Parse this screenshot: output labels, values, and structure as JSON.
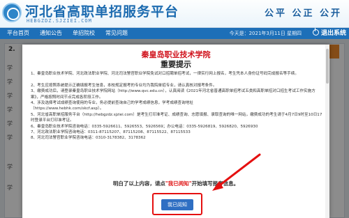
{
  "header": {
    "title": "河北省高职单招服务平台",
    "url": "HEBGZDZ.SJZIEI.COM",
    "slogan": "公平  公正  公开"
  },
  "nav": {
    "items": [
      "平台首页",
      "通知公告",
      "单招院校",
      "常见问题"
    ],
    "date": "今天是：2021年3月11日 星期四",
    "logout": "退出系统"
  },
  "background": {
    "step": "2.",
    "labels": [
      "学",
      "学",
      "学",
      "学",
      "学",
      "学",
      "学",
      "学"
    ]
  },
  "modal": {
    "school": "秦皇岛职业技术学院",
    "title": "重要提示",
    "notices": [
      "1、秦皇岛职业技术学院、河北政法职业学院、河北司法警官职业学院免试对口招聘单招考试，一律实行网上报名，考生凭本人身份证号码完成报名等手续。",
      "2、考生应按照系统提示正确填报考生信息，本校规定报考的专业均为我院单招专业，请认真核对报考条件。",
      "3、缴费成功后，请登录秦皇岛职业技术学院网站（http://www.qvc.edu.cn），认真阅读《2021年河北省普通高职单招考试五类和高职单招对口招生考试工作实施方案》，严格按照时间节点完成各阶段工作。",
      "4、涉及选择考试成绩查询使用的专业，务必提前查询自己的学考成绩信息，学考成绩查询地址",
      "（https://www.hebhk.com/skcf.asp）。",
      "5、河北省高职单招服务平台（http://hebgzdz.sjziei.com）是考生打印准考证、成绩查询、志愿填报、录取查询的唯一网站，缴费成功的考生请于4月7日9时至10日17时登录平台打印准考证。",
      "6、秦皇岛职业技术学院咨询电话：0335-5926611、5926553、5926569；办公电话：0335-5926819、5926820、5926930",
      "7、河北政法职业学院咨询电话：0311-87115207、87115208、87115522、87115533",
      "8、河北司法警官职业学院咨询电话：0310-3178382、3178362"
    ],
    "confirm_prefix": "明白了以上内容，请点",
    "confirm_highlight": "\"我已阅知\"",
    "confirm_suffix": "开始填写报考信息。",
    "ok_button": "我已阅知"
  }
}
